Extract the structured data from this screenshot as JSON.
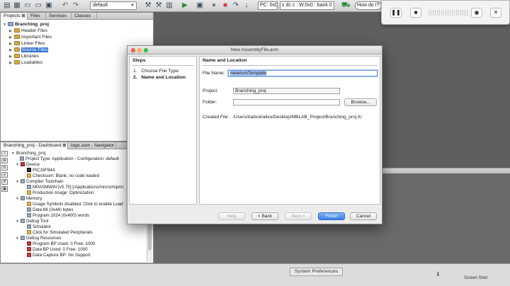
{
  "toolbar": {
    "config_select": "default",
    "status_pc": "PC: 0x0",
    "status_flags": "z dc c",
    "status_w": ": W:0x0 : bank 0",
    "search_text": "How do I?"
  },
  "projects_panel": {
    "tabs": [
      "Projects",
      "Files",
      "Services",
      "Classes"
    ],
    "root": "Branching_proj",
    "items": [
      "Header Files",
      "Important Files",
      "Linker Files",
      "Source Files",
      "Libraries",
      "Loadables"
    ]
  },
  "dashboard_panel": {
    "tabs": [
      "Branching_proj - Dashboard",
      "logic.asm - Navigator"
    ],
    "rows": [
      "Branching_proj",
      "Project Type: Application - Configuration: default",
      "Device",
      "PIC16F84A",
      "Checksum: Blank, no code loaded",
      "Compiler Toolchain",
      "MPASMWIN [v5.75] [/Applications/microchip/m",
      "Production Image: Optimization:",
      "Memory",
      "Usage Symbols disabled. Click to enable Load",
      "Data 68 (0x44) bytes",
      "Program 1024 (0x400) words",
      "Debug Tool",
      "Simulator",
      "Click for Simulated Peripherals",
      "Debug Resources",
      "Program BP Used: 0  Free: 1000",
      "Data BP Used: 0  Free: 1000",
      "Data Capture BP: No Support"
    ]
  },
  "dialog": {
    "title": "New AssemblyFile.asm",
    "steps_header": "Steps",
    "steps": [
      {
        "num": "1.",
        "label": "Choose File Type"
      },
      {
        "num": "2.",
        "label": "Name and Location"
      }
    ],
    "section_title": "Name and Location",
    "file_name_label": "File Name:",
    "file_name_value": "newAsmTemplate",
    "project_label": "Project:",
    "project_value": "Branching_proj",
    "folder_label": "Folder:",
    "folder_value": "",
    "browse_label": "Browse...",
    "created_file_label": "Created File:",
    "created_file_value": "/Users/trailxotrailxo/Desktop/MBLAB_Project/Branching_proj.X/",
    "buttons": {
      "help": "Help",
      "back": "< Back",
      "next": "Next >",
      "finish": "Finish",
      "cancel": "Cancel"
    }
  },
  "tooltip": "System Preferences",
  "screenshot_label": "Screen Shot",
  "colors": {
    "selection": "#3875d7",
    "primary_button": "#3c82e6",
    "desktop": "#5f5f5f"
  }
}
